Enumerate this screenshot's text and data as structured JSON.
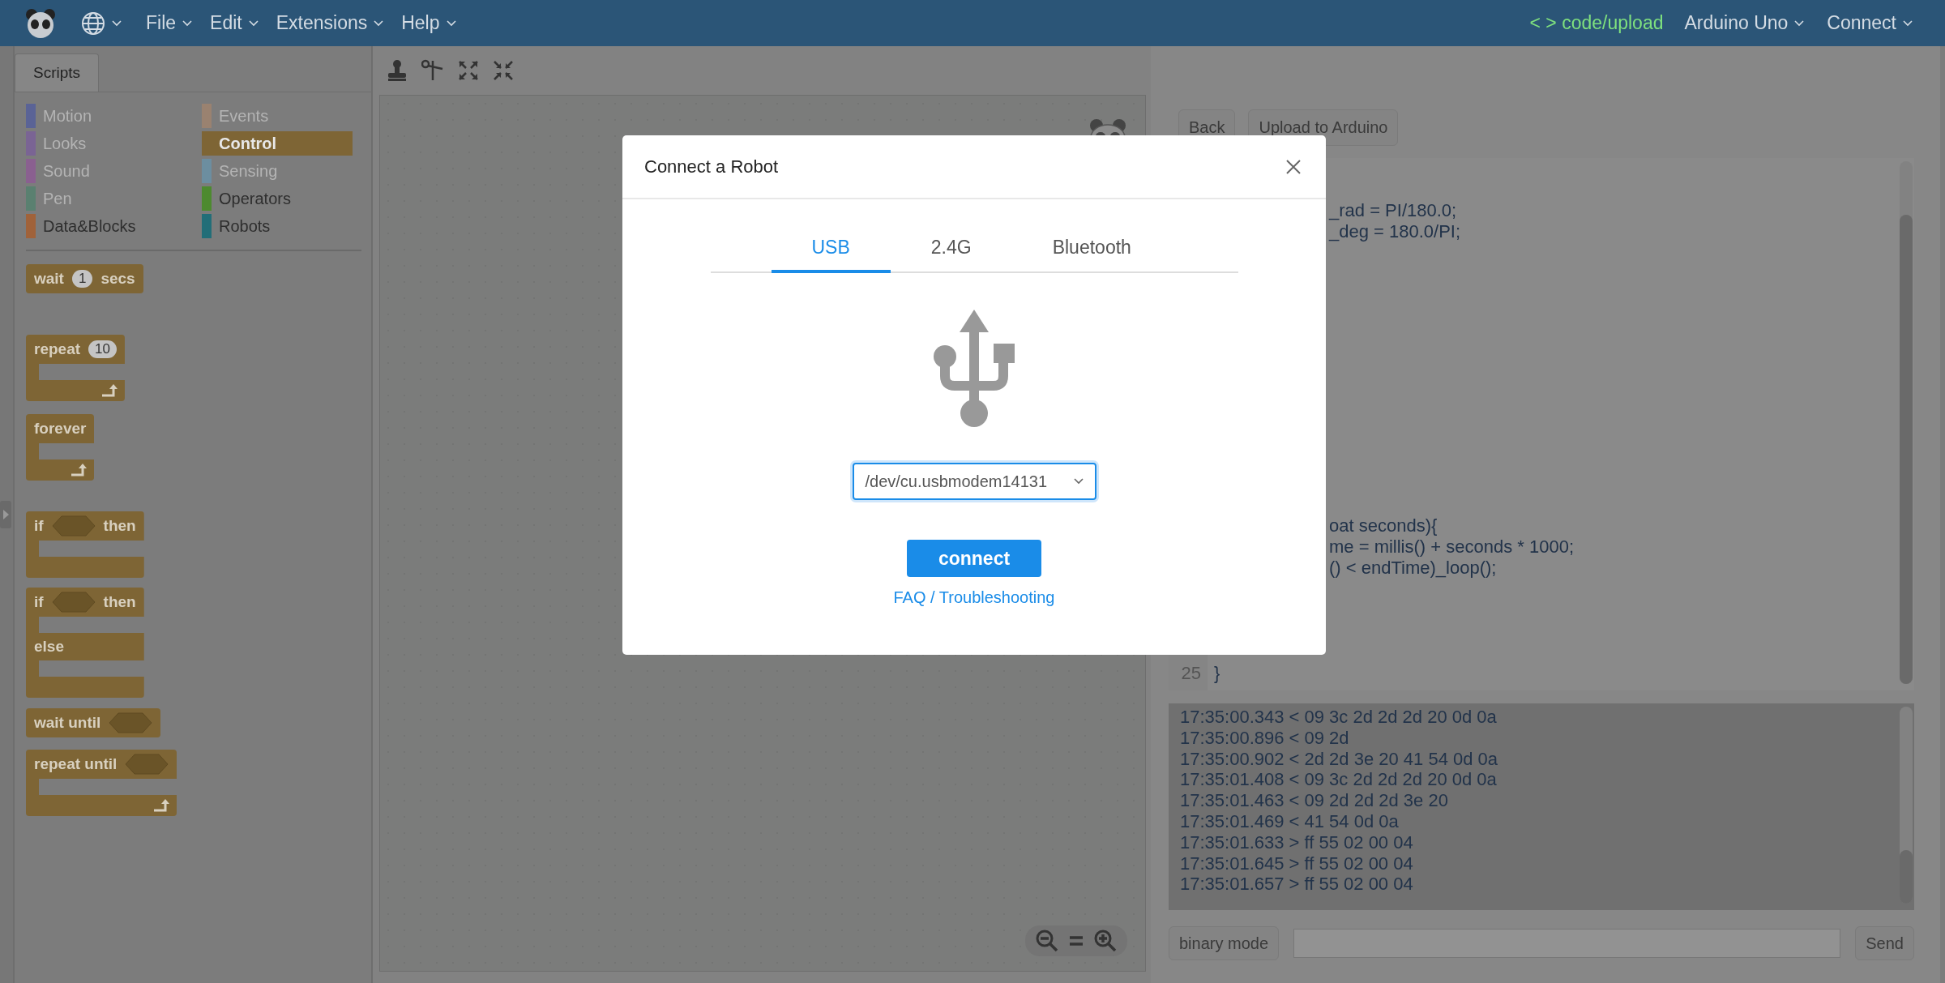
{
  "menu_bar": {
    "menus": [
      {
        "label": "File"
      },
      {
        "label": "Edit"
      },
      {
        "label": "Extensions"
      },
      {
        "label": "Help"
      }
    ],
    "code_toggle": "< > code/upload",
    "board": "Arduino Uno",
    "connect": "Connect"
  },
  "palette": {
    "tab": {
      "label": "Scripts",
      "selected": true
    },
    "categories": [
      {
        "label": "Motion",
        "color": "#5a6396",
        "disabled": true,
        "selected": false
      },
      {
        "label": "Looks",
        "color": "#7a6494",
        "disabled": true,
        "selected": false
      },
      {
        "label": "Sound",
        "color": "#8a6090",
        "disabled": true,
        "selected": false
      },
      {
        "label": "Pen",
        "color": "#5a8070",
        "disabled": true,
        "selected": false
      },
      {
        "label": "Data&Blocks",
        "color": "#a0623a",
        "disabled": false,
        "selected": false
      },
      {
        "label": "Events",
        "color": "#9a8270",
        "disabled": true,
        "selected": false
      },
      {
        "label": "Control",
        "color": "#7e6535",
        "disabled": false,
        "selected": true
      },
      {
        "label": "Sensing",
        "color": "#6c8ea0",
        "disabled": true,
        "selected": false
      },
      {
        "label": "Operators",
        "color": "#4d8a2f",
        "disabled": false,
        "selected": false
      },
      {
        "label": "Robots",
        "color": "#226e78",
        "disabled": false,
        "selected": false
      }
    ],
    "blocks": [
      {
        "kind": "command",
        "parts": [
          {
            "kind": "label",
            "text": "wait"
          },
          {
            "kind": "number",
            "text": "1"
          },
          {
            "kind": "label",
            "text": "secs"
          }
        ]
      },
      {
        "kind": "loop",
        "parts": [
          {
            "kind": "label",
            "text": "repeat"
          },
          {
            "kind": "number",
            "text": "10"
          }
        ]
      },
      {
        "kind": "loop",
        "parts": [
          {
            "kind": "label",
            "text": "forever"
          }
        ]
      },
      {
        "kind": "if",
        "parts": [
          {
            "kind": "label",
            "text": "if"
          },
          {
            "kind": "condition"
          },
          {
            "kind": "label",
            "text": "then"
          }
        ]
      },
      {
        "kind": "if-else",
        "parts": [
          {
            "kind": "label",
            "text": "if"
          },
          {
            "kind": "condition"
          },
          {
            "kind": "label",
            "text": "then"
          }
        ],
        "else_label": "else"
      },
      {
        "kind": "command",
        "parts": [
          {
            "kind": "label",
            "text": "wait until"
          },
          {
            "kind": "condition"
          }
        ]
      },
      {
        "kind": "loop",
        "parts": [
          {
            "kind": "label",
            "text": "repeat until"
          },
          {
            "kind": "condition"
          }
        ]
      }
    ]
  },
  "code_panel": {
    "buttons": [
      "Back",
      "Upload to Arduino"
    ],
    "code": {
      "top_fragments": [
        "_rad = PI/180.0;",
        "_deg = 180.0/PI;"
      ],
      "middle_fragments": [
        "oat seconds){",
        "me = millis() + seconds * 1000;",
        "() < endTime)_loop();"
      ],
      "last_line": {
        "number": "25",
        "text": "}"
      }
    },
    "console": [
      "17:35:00.343 < 09 3c 2d 2d 2d 20 0d 0a",
      "17:35:00.896 < 09 2d",
      "17:35:00.902 < 2d 2d 3e 20 41 54 0d 0a",
      "17:35:01.408 < 09 3c 2d 2d 2d 20 0d 0a",
      "17:35:01.463 < 09 2d 2d 2d 3e 20",
      "17:35:01.469 < 41 54 0d 0a",
      "17:35:01.633 > ff 55 02 00 04",
      "17:35:01.645 > ff 55 02 00 04",
      "17:35:01.657 > ff 55 02 00 04"
    ],
    "binary_mode": "binary mode",
    "send": "Send"
  },
  "dialog": {
    "title": "Connect a Robot",
    "tabs": [
      {
        "label": "USB",
        "selected": true
      },
      {
        "label": "2.4G",
        "selected": false
      },
      {
        "label": "Bluetooth",
        "selected": false
      }
    ],
    "port": "/dev/cu.usbmodem14131",
    "connect": "connect",
    "help_link": "FAQ / Troubleshooting"
  }
}
